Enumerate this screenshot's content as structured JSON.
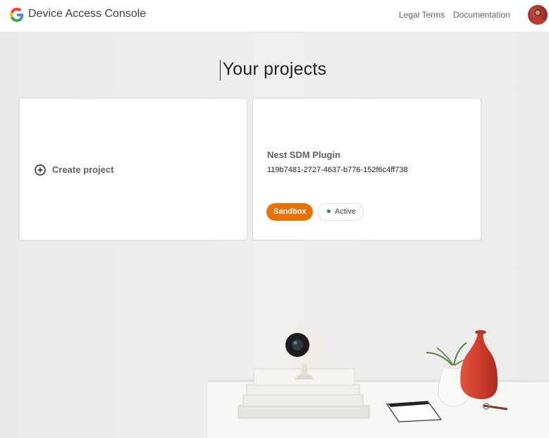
{
  "header": {
    "logo_icon": "google-g-logo",
    "app_title": "Device Access Console",
    "links": [
      "Legal Terms",
      "Documentation"
    ],
    "avatar_icon": "user-avatar"
  },
  "main": {
    "title": "Your projects",
    "create_card": {
      "icon": "add-circle-icon",
      "label": "Create project"
    },
    "projects": [
      {
        "name": "Nest SDM Plugin",
        "id": "119b7481-2727-4637-b776-152f6c4ff738",
        "environment": "Sandbox",
        "status": "Active"
      }
    ]
  },
  "colors": {
    "sandbox": "#e8710a",
    "active_dot": "#1e8e3e",
    "background": "#ececeb",
    "card": "#ffffff"
  }
}
